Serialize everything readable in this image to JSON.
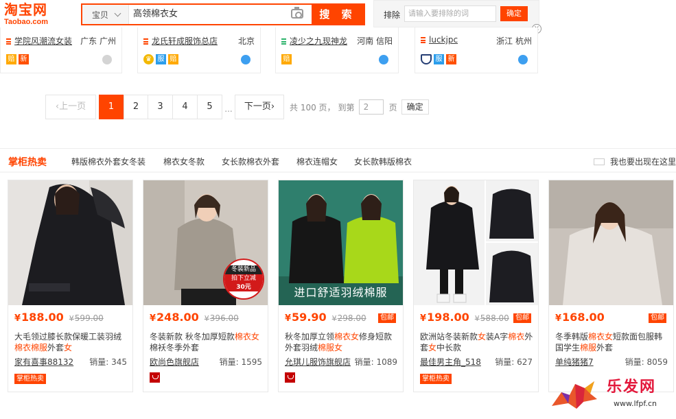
{
  "header": {
    "logo_cn": "淘宝网",
    "logo_en": "Taobao.com",
    "scope": "宝贝",
    "query": "高领棉衣女",
    "search_button": "搜 索",
    "exclude_label": "排除",
    "exclude_placeholder": "请输入要排除的词",
    "exclude_ok": "确定",
    "close": "×"
  },
  "shops": [
    {
      "name": "学院风潮流女装",
      "location": "广东 广州",
      "badges": [
        "赔",
        "新"
      ]
    },
    {
      "name": "龙氏轩成服饰总店",
      "location": "北京",
      "badges": [
        "👑",
        "服",
        "赔"
      ]
    },
    {
      "name": "凌少之九现神龙",
      "location": "河南 信阳",
      "badges": [
        "赔"
      ]
    },
    {
      "name": "luckjpc",
      "location": "浙江 杭州",
      "badges": [
        "盾",
        "服",
        "新"
      ]
    }
  ],
  "pagination": {
    "prev": "上一页",
    "pages": [
      "1",
      "2",
      "3",
      "4",
      "5"
    ],
    "current": "1",
    "ellipsis": "...",
    "next": "下一页",
    "total": "共 100 页，",
    "goto_label": "到第",
    "goto_value": "2",
    "page_unit": "页",
    "ok": "确定"
  },
  "hot": {
    "title": "掌柜热卖",
    "keywords": [
      "韩版棉衣外套女冬装",
      "棉衣女冬款",
      "女长款棉衣外套",
      "棉衣连帽女",
      "女长款韩版棉衣"
    ],
    "promo": "我也要出现在这里"
  },
  "products": [
    {
      "price": "188.00",
      "old": "599.00",
      "tag": "",
      "title_pre": "大毛领过膝长款保暖工装羽绒",
      "title_hl": "棉衣棉服",
      "title_post": "外套",
      "title_hl2": "女",
      "shop": "家有喜事88132",
      "sales": "销量: 345",
      "bottom": "掌柜热卖",
      "overlay": ""
    },
    {
      "price": "248.00",
      "old": "396.00",
      "tag": "",
      "title_pre": "冬装新款 秋冬加厚短款",
      "title_hl": "棉衣女",
      "title_post": "棉袄冬季外套",
      "title_hl2": "",
      "shop": "欧尚色旗舰店",
      "sales": "销量: 1595",
      "bottom": "",
      "overlay": "冬装新品 拍下立减 30元"
    },
    {
      "price": "59.90",
      "old": "298.00",
      "tag": "包邮",
      "title_pre": "秋冬加厚立领",
      "title_hl": "棉衣女",
      "title_post": "修身短款外套羽绒",
      "title_hl2": "棉服女",
      "shop": "允琪儿服饰旗舰店",
      "sales": "销量: 1089",
      "bottom": "",
      "overlay": "进口舒适羽绒棉服"
    },
    {
      "price": "198.00",
      "old": "588.00",
      "tag": "包邮",
      "title_pre": "欧洲站冬装新款",
      "title_hl": "女",
      "title_post": "装A字",
      "title_hl2": "棉衣",
      "title_post2": "外套",
      "title_hl3": "女",
      "title_post3": "中长款",
      "shop": "最佳男主角_518",
      "sales": "销量: 627",
      "bottom": "掌柜热卖",
      "overlay": ""
    },
    {
      "price": "168.00",
      "old": "",
      "tag": "包邮",
      "title_pre": "冬季韩版",
      "title_hl": "棉衣女",
      "title_post": "短款面包服韩国学生",
      "title_hl2": "棉服",
      "title_post2": "外套",
      "shop": "单纯猪猪7",
      "sales": "销量: 8059",
      "bottom": "",
      "overlay": ""
    }
  ],
  "currency": "¥",
  "watermark": {
    "text": "乐发网",
    "url": "www.lfpf.cn"
  },
  "colors": {
    "accent": "#ff4400",
    "sub": "#ff5000"
  }
}
